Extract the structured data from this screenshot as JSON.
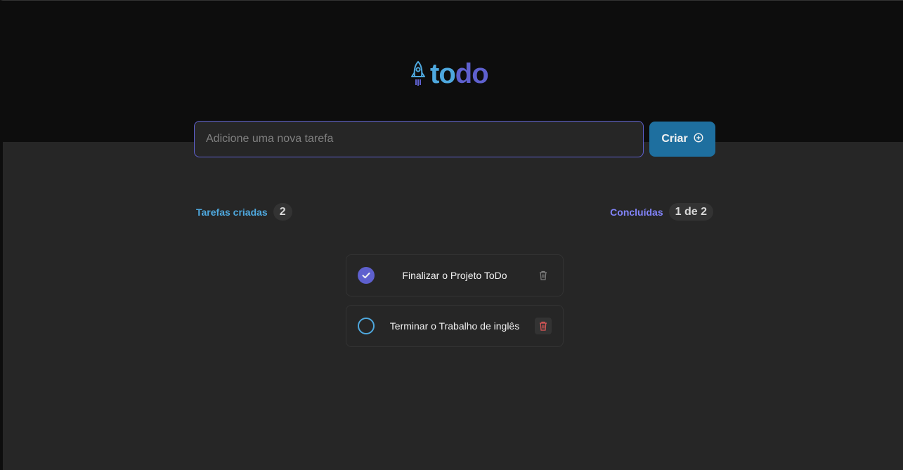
{
  "header": {
    "logo_icon": "rocket-icon",
    "logo_part1": "to",
    "logo_part2": "do"
  },
  "new_task": {
    "placeholder": "Adicione uma nova tarefa",
    "value": "",
    "button_label": "Criar",
    "button_icon": "plus-circle-icon"
  },
  "counters": {
    "created_label": "Tarefas criadas",
    "created_count": "2",
    "done_label": "Concluídas",
    "done_count": "1 de 2"
  },
  "tasks": [
    {
      "text": "Finalizar o Projeto ToDo",
      "completed": true,
      "delete_icon": "trash-icon"
    },
    {
      "text": "Terminar o Trabalho de inglês",
      "completed": false,
      "delete_icon": "trash-icon"
    }
  ],
  "colors": {
    "blue": "#4ea8de",
    "purple": "#5e60ce",
    "purple_light": "#8284fa",
    "blue_dark": "#1e6f9f",
    "danger": "#e25858"
  }
}
